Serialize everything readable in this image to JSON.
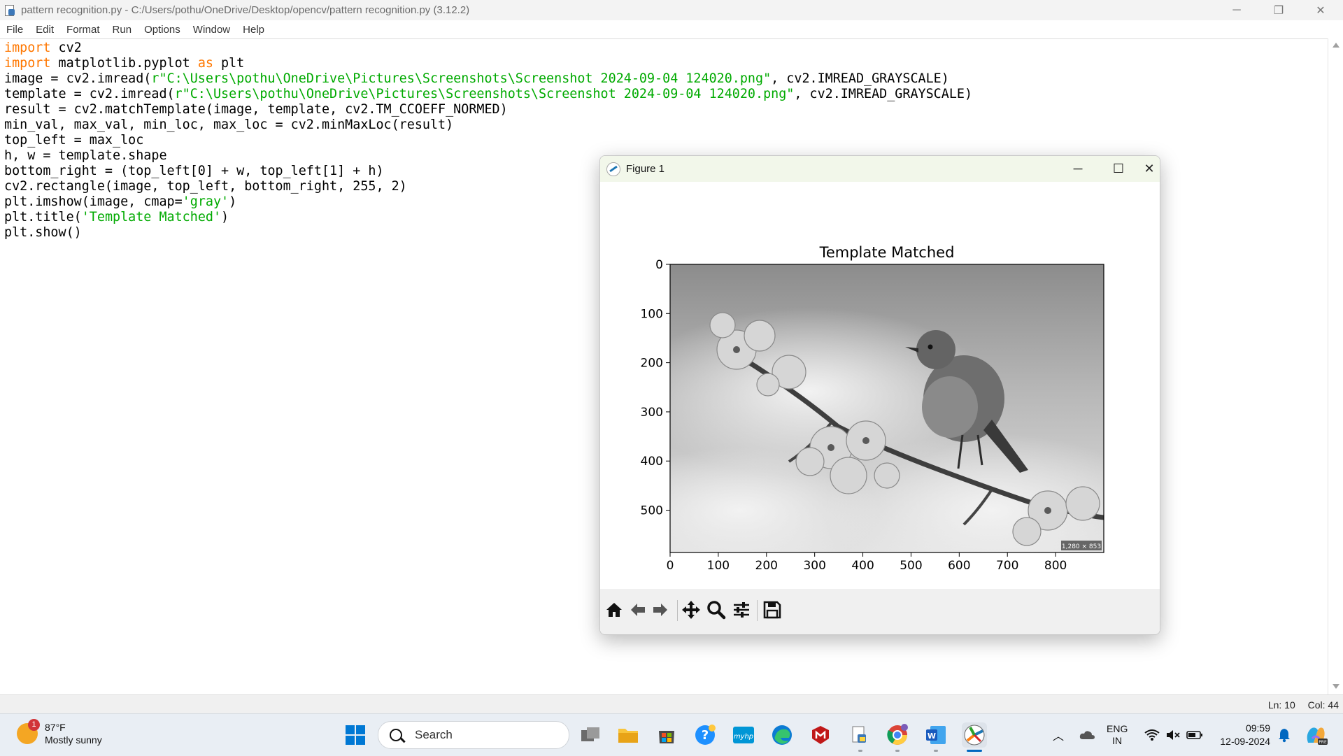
{
  "window": {
    "title": "pattern recognition.py - C:/Users/pothu/OneDrive/Desktop/opencv/pattern recognition.py (3.12.2)",
    "minimize": "─",
    "restore": "❐",
    "close": "✕"
  },
  "menu": [
    "File",
    "Edit",
    "Format",
    "Run",
    "Options",
    "Window",
    "Help"
  ],
  "code_lines": [
    [
      {
        "t": "import",
        "c": "kw"
      },
      {
        "t": " cv2"
      }
    ],
    [
      {
        "t": "import",
        "c": "kw"
      },
      {
        "t": " matplotlib.pyplot "
      },
      {
        "t": "as",
        "c": "kw"
      },
      {
        "t": " plt"
      }
    ],
    [
      {
        "t": "image = cv2.imread("
      },
      {
        "t": "r\"C:\\Users\\pothu\\OneDrive\\Pictures\\Screenshots\\Screenshot 2024-09-04 124020.png\"",
        "c": "str"
      },
      {
        "t": ", cv2.IMREAD_GRAYSCALE)"
      }
    ],
    [
      {
        "t": "template = cv2.imread("
      },
      {
        "t": "r\"C:\\Users\\pothu\\OneDrive\\Pictures\\Screenshots\\Screenshot 2024-09-04 124020.png\"",
        "c": "str"
      },
      {
        "t": ", cv2.IMREAD_GRAYSCALE)"
      }
    ],
    [
      {
        "t": "result = cv2.matchTemplate(image, template, cv2.TM_CCOEFF_NORMED)"
      }
    ],
    [
      {
        "t": "min_val, max_val, min_loc, max_loc = cv2.minMaxLoc(result)"
      }
    ],
    [
      {
        "t": "top_left = max_loc"
      }
    ],
    [
      {
        "t": "h, w = template.shape"
      }
    ],
    [
      {
        "t": "bottom_right = (top_left[0] + w, top_left[1] + h)"
      }
    ],
    [
      {
        "t": "cv2.rectangle(image, top_left, bottom_right, 255, 2)"
      }
    ],
    [
      {
        "t": "plt.imshow(image, cmap="
      },
      {
        "t": "'gray'",
        "c": "str"
      },
      {
        "t": ")"
      }
    ],
    [
      {
        "t": "plt.title("
      },
      {
        "t": "'Template Matched'",
        "c": "str"
      },
      {
        "t": ")"
      }
    ],
    [
      {
        "t": "plt.show()"
      }
    ]
  ],
  "status": {
    "line": "Ln: 10",
    "col": "Col: 44"
  },
  "figure": {
    "title": "Figure 1",
    "plot_title": "Template Matched",
    "x_ticks": [
      "0",
      "100",
      "200",
      "300",
      "400",
      "500",
      "600",
      "700",
      "800"
    ],
    "y_ticks": [
      "0",
      "100",
      "200",
      "300",
      "400",
      "500"
    ],
    "image_badge": "1,280 × 853",
    "toolbar_icons": [
      "home-icon",
      "back-arrow-icon",
      "forward-arrow-icon",
      "pan-icon",
      "zoom-icon",
      "configure-subplots-icon",
      "save-icon"
    ]
  },
  "taskbar": {
    "weather_temp": "87°F",
    "weather_desc": "Mostly sunny",
    "weather_badge": "1",
    "search_placeholder": "Search",
    "lang_top": "ENG",
    "lang_bottom": "IN",
    "time": "09:59",
    "date": "12-09-2024",
    "colors": {
      "accent": "#0067c0",
      "taskbar_bg": "#e9eef4"
    }
  }
}
